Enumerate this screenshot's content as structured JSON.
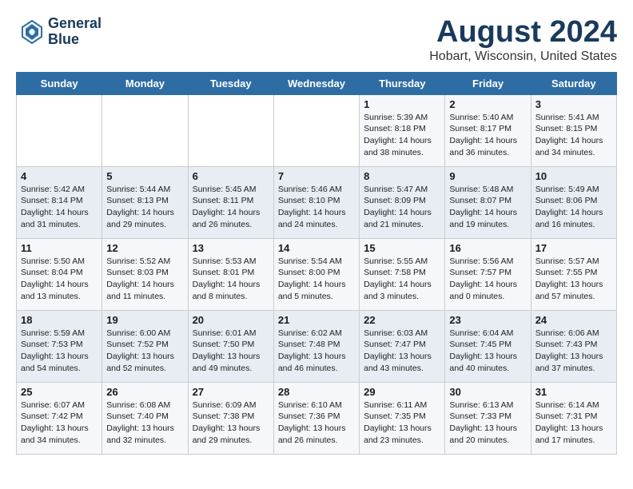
{
  "logo": {
    "line1": "General",
    "line2": "Blue"
  },
  "title": "August 2024",
  "subtitle": "Hobart, Wisconsin, United States",
  "days_of_week": [
    "Sunday",
    "Monday",
    "Tuesday",
    "Wednesday",
    "Thursday",
    "Friday",
    "Saturday"
  ],
  "weeks": [
    [
      {
        "day": "",
        "info": ""
      },
      {
        "day": "",
        "info": ""
      },
      {
        "day": "",
        "info": ""
      },
      {
        "day": "",
        "info": ""
      },
      {
        "day": "1",
        "info": "Sunrise: 5:39 AM\nSunset: 8:18 PM\nDaylight: 14 hours\nand 38 minutes."
      },
      {
        "day": "2",
        "info": "Sunrise: 5:40 AM\nSunset: 8:17 PM\nDaylight: 14 hours\nand 36 minutes."
      },
      {
        "day": "3",
        "info": "Sunrise: 5:41 AM\nSunset: 8:15 PM\nDaylight: 14 hours\nand 34 minutes."
      }
    ],
    [
      {
        "day": "4",
        "info": "Sunrise: 5:42 AM\nSunset: 8:14 PM\nDaylight: 14 hours\nand 31 minutes."
      },
      {
        "day": "5",
        "info": "Sunrise: 5:44 AM\nSunset: 8:13 PM\nDaylight: 14 hours\nand 29 minutes."
      },
      {
        "day": "6",
        "info": "Sunrise: 5:45 AM\nSunset: 8:11 PM\nDaylight: 14 hours\nand 26 minutes."
      },
      {
        "day": "7",
        "info": "Sunrise: 5:46 AM\nSunset: 8:10 PM\nDaylight: 14 hours\nand 24 minutes."
      },
      {
        "day": "8",
        "info": "Sunrise: 5:47 AM\nSunset: 8:09 PM\nDaylight: 14 hours\nand 21 minutes."
      },
      {
        "day": "9",
        "info": "Sunrise: 5:48 AM\nSunset: 8:07 PM\nDaylight: 14 hours\nand 19 minutes."
      },
      {
        "day": "10",
        "info": "Sunrise: 5:49 AM\nSunset: 8:06 PM\nDaylight: 14 hours\nand 16 minutes."
      }
    ],
    [
      {
        "day": "11",
        "info": "Sunrise: 5:50 AM\nSunset: 8:04 PM\nDaylight: 14 hours\nand 13 minutes."
      },
      {
        "day": "12",
        "info": "Sunrise: 5:52 AM\nSunset: 8:03 PM\nDaylight: 14 hours\nand 11 minutes."
      },
      {
        "day": "13",
        "info": "Sunrise: 5:53 AM\nSunset: 8:01 PM\nDaylight: 14 hours\nand 8 minutes."
      },
      {
        "day": "14",
        "info": "Sunrise: 5:54 AM\nSunset: 8:00 PM\nDaylight: 14 hours\nand 5 minutes."
      },
      {
        "day": "15",
        "info": "Sunrise: 5:55 AM\nSunset: 7:58 PM\nDaylight: 14 hours\nand 3 minutes."
      },
      {
        "day": "16",
        "info": "Sunrise: 5:56 AM\nSunset: 7:57 PM\nDaylight: 14 hours\nand 0 minutes."
      },
      {
        "day": "17",
        "info": "Sunrise: 5:57 AM\nSunset: 7:55 PM\nDaylight: 13 hours\nand 57 minutes."
      }
    ],
    [
      {
        "day": "18",
        "info": "Sunrise: 5:59 AM\nSunset: 7:53 PM\nDaylight: 13 hours\nand 54 minutes."
      },
      {
        "day": "19",
        "info": "Sunrise: 6:00 AM\nSunset: 7:52 PM\nDaylight: 13 hours\nand 52 minutes."
      },
      {
        "day": "20",
        "info": "Sunrise: 6:01 AM\nSunset: 7:50 PM\nDaylight: 13 hours\nand 49 minutes."
      },
      {
        "day": "21",
        "info": "Sunrise: 6:02 AM\nSunset: 7:48 PM\nDaylight: 13 hours\nand 46 minutes."
      },
      {
        "day": "22",
        "info": "Sunrise: 6:03 AM\nSunset: 7:47 PM\nDaylight: 13 hours\nand 43 minutes."
      },
      {
        "day": "23",
        "info": "Sunrise: 6:04 AM\nSunset: 7:45 PM\nDaylight: 13 hours\nand 40 minutes."
      },
      {
        "day": "24",
        "info": "Sunrise: 6:06 AM\nSunset: 7:43 PM\nDaylight: 13 hours\nand 37 minutes."
      }
    ],
    [
      {
        "day": "25",
        "info": "Sunrise: 6:07 AM\nSunset: 7:42 PM\nDaylight: 13 hours\nand 34 minutes."
      },
      {
        "day": "26",
        "info": "Sunrise: 6:08 AM\nSunset: 7:40 PM\nDaylight: 13 hours\nand 32 minutes."
      },
      {
        "day": "27",
        "info": "Sunrise: 6:09 AM\nSunset: 7:38 PM\nDaylight: 13 hours\nand 29 minutes."
      },
      {
        "day": "28",
        "info": "Sunrise: 6:10 AM\nSunset: 7:36 PM\nDaylight: 13 hours\nand 26 minutes."
      },
      {
        "day": "29",
        "info": "Sunrise: 6:11 AM\nSunset: 7:35 PM\nDaylight: 13 hours\nand 23 minutes."
      },
      {
        "day": "30",
        "info": "Sunrise: 6:13 AM\nSunset: 7:33 PM\nDaylight: 13 hours\nand 20 minutes."
      },
      {
        "day": "31",
        "info": "Sunrise: 6:14 AM\nSunset: 7:31 PM\nDaylight: 13 hours\nand 17 minutes."
      }
    ]
  ]
}
